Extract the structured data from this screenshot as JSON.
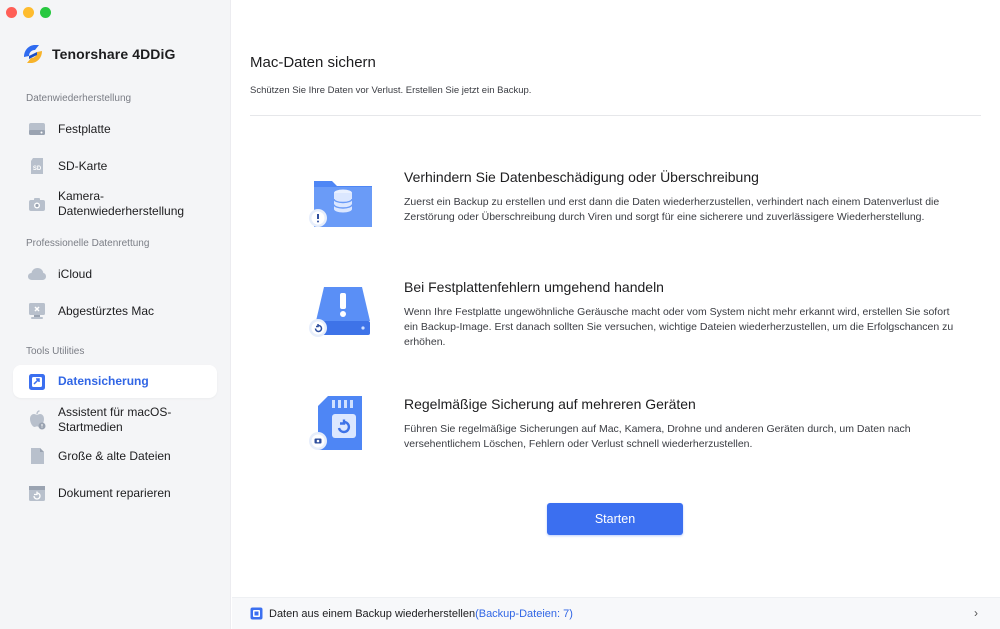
{
  "app": {
    "name": "Tenorshare 4DDiG"
  },
  "colors": {
    "accent": "#3b6ff0",
    "active_text": "#3166e5",
    "sidebar_bg": "#f4f5f7"
  },
  "sidebar": {
    "sections": [
      {
        "title": "Datenwiederherstellung"
      },
      {
        "title": "Professionelle Datenrettung"
      },
      {
        "title": "Tools  Utilities"
      }
    ],
    "items": [
      {
        "label": "Festplatte",
        "icon": "hard-drive-icon"
      },
      {
        "label": "SD-Karte",
        "icon": "sd-card-icon"
      },
      {
        "label": "Kamera-Datenwiederherstellung",
        "line1": "Kamera-",
        "line2": "Datenwiederherstellung",
        "icon": "camera-icon"
      },
      {
        "label": "iCloud",
        "icon": "cloud-icon"
      },
      {
        "label": "Abgestürztes Mac",
        "icon": "crashed-mac-icon"
      },
      {
        "label": "Datensicherung",
        "icon": "backup-icon",
        "active": true
      },
      {
        "label": "Assistent für macOS-Startmedien",
        "line1": "Assistent für macOS-",
        "line2": "Startmedien",
        "icon": "apple-icon"
      },
      {
        "label": "Große & alte Dateien",
        "icon": "file-icon"
      },
      {
        "label": "Dokument reparieren",
        "icon": "document-repair-icon"
      }
    ]
  },
  "main": {
    "title": "Mac-Daten sichern",
    "subtitle": "Schützen Sie Ihre Daten vor Verlust. Erstellen Sie jetzt ein Backup.",
    "features": [
      {
        "title": "Verhindern Sie Datenbeschädigung oder Überschreibung",
        "description": "Zuerst ein Backup zu erstellen und erst dann die Daten wiederherzustellen, verhindert nach einem Datenverlust die Zerstörung oder Überschreibung durch Viren und sorgt für eine sicherere und zuverlässigere Wiederherstellung.",
        "icon": "database-folder-icon"
      },
      {
        "title": "Bei Festplattenfehlern umgehend handeln",
        "description": "Wenn Ihre Festplatte ungewöhnliche Geräusche macht oder vom System nicht mehr erkannt wird, erstellen Sie sofort ein Backup-Image. Erst danach sollten Sie versuchen, wichtige Dateien wiederherzustellen, um die Erfolgschancen zu erhöhen.",
        "icon": "disk-warning-icon"
      },
      {
        "title": "Regelmäßige Sicherung auf mehreren Geräten",
        "description": "Führen Sie regelmäßige Sicherungen auf Mac, Kamera, Drohne und anderen Geräten durch, um Daten nach versehentlichem Löschen, Fehlern oder Verlust schnell wiederherzustellen.",
        "icon": "sd-card-sync-icon"
      }
    ],
    "start_button": "Starten"
  },
  "footer": {
    "text": "Daten aus einem Backup wiederherstellen",
    "count": "(Backup-Dateien: 7)",
    "chevron": "›"
  }
}
